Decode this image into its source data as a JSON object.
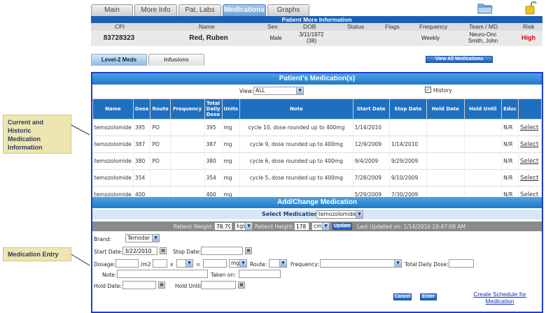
{
  "tabs": [
    {
      "label": "Main",
      "active": false
    },
    {
      "label": "More Info",
      "active": false
    },
    {
      "label": "Pat. Labs",
      "active": false
    },
    {
      "label": "Medications",
      "active": true
    },
    {
      "label": "Graphs",
      "active": false
    }
  ],
  "patient": {
    "bar_title": "Patient More Information",
    "headers": {
      "cpi": "CPI",
      "name": "Name",
      "sex": "Sex",
      "dob": "DOB",
      "status": "Status",
      "flags": "Flags",
      "frequency": "Frequency",
      "team": "Team / MD",
      "risk": "Risk"
    },
    "cpi": "83728323",
    "name": "Red, Ruben",
    "sex": "Male",
    "dob": "3/11/1972",
    "age": "(38)",
    "frequency": "Weekly",
    "team": "Neuro-Onc",
    "md": "Smith, John",
    "risk": "High",
    "risk_color": "#e00000"
  },
  "subtabs": [
    {
      "label": "Level-2 Meds",
      "active": true
    },
    {
      "label": "Infusions",
      "active": false
    }
  ],
  "view_all_button": "View All Medications",
  "meds_panel": {
    "title": "Patient's Medication(s)",
    "view_label": "View:",
    "view_value": "ALL",
    "history_label": "History",
    "history_checked": true,
    "columns": [
      "Name",
      "Dose",
      "Route",
      "Frequency",
      "Total Daily Dose",
      "Units",
      "Note",
      "Start Date",
      "Stop Date",
      "Hold Date",
      "Hold Until",
      "Educ",
      ""
    ],
    "rows": [
      {
        "name": "temozolomide",
        "dose": "395",
        "route": "PO",
        "frequency": "",
        "total": "395",
        "units": "mg",
        "note": "cycle 10, dose rounded up to 400mg",
        "start": "1/14/2010",
        "stop": "",
        "hold": "",
        "hold_until": "",
        "educ": "N/R",
        "action": "Select"
      },
      {
        "name": "temozolomide",
        "dose": "387",
        "route": "PO",
        "frequency": "",
        "total": "387",
        "units": "mg",
        "note": "cycle 9, dose rounded up to 400mg",
        "start": "12/9/2009",
        "stop": "1/14/2010",
        "hold": "",
        "hold_until": "",
        "educ": "N/R",
        "action": "Select"
      },
      {
        "name": "temozolomide",
        "dose": "380",
        "route": "PO",
        "frequency": "",
        "total": "380",
        "units": "mg",
        "note": "cycle 6, dose rounded up to 400mg",
        "start": "9/4/2009",
        "stop": "9/29/2009",
        "hold": "",
        "hold_until": "",
        "educ": "N/R",
        "action": "Select"
      },
      {
        "name": "temozolomide",
        "dose": "354",
        "route": "",
        "frequency": "",
        "total": "354",
        "units": "mg",
        "note": "cycle 5, dose rounded up to 400mg",
        "start": "7/28/2009",
        "stop": "9/10/2009",
        "hold": "",
        "hold_until": "",
        "educ": "N/R",
        "action": "Select"
      },
      {
        "name": "temozolomide",
        "dose": "400",
        "route": "",
        "frequency": "",
        "total": "400",
        "units": "mg",
        "note": "",
        "start": "5/29/2009",
        "stop": "7/30/2009",
        "hold": "",
        "hold_until": "",
        "educ": "N/R",
        "action": "Select"
      }
    ]
  },
  "entry": {
    "title": "Add/Change Medication",
    "select_label": "Select Medication:",
    "select_value": "temozolomide",
    "weight_label": "Patient Weight:",
    "weight_value": "78.79",
    "weight_unit": "kgs",
    "height_label": "Patient Height:",
    "height_value": "178",
    "height_unit": "cm",
    "update_button": "Update",
    "last_updated": "Last Updated on: 1/14/2010 10:47:00 AM",
    "brand_label": "Brand:",
    "brand_value": "Temodar",
    "start_label": "Start Date:",
    "start_value": "3/22/2010",
    "stop_label": "Stop Date:",
    "dosage_label": "Dosage:",
    "per_m2": "/m2",
    "times": "x",
    "equals": "=",
    "unit_value": "mg",
    "route_label": "Route:",
    "frequency_label": "Frequency:",
    "total_label": "Total Daily Dose:",
    "note_label": "Note:",
    "taken_label": "Taken on:",
    "hold_label": "Hold Date:",
    "hold_until_label": "Hold Until:",
    "cancel_button": "Cancel",
    "enter_button": "Enter",
    "schedule_link_1": "Create Schedule for",
    "schedule_link_2": "Medication"
  },
  "callouts": {
    "current": [
      "Current and",
      "Historic",
      "Medication",
      "Information"
    ],
    "entry": "Medication Entry"
  }
}
